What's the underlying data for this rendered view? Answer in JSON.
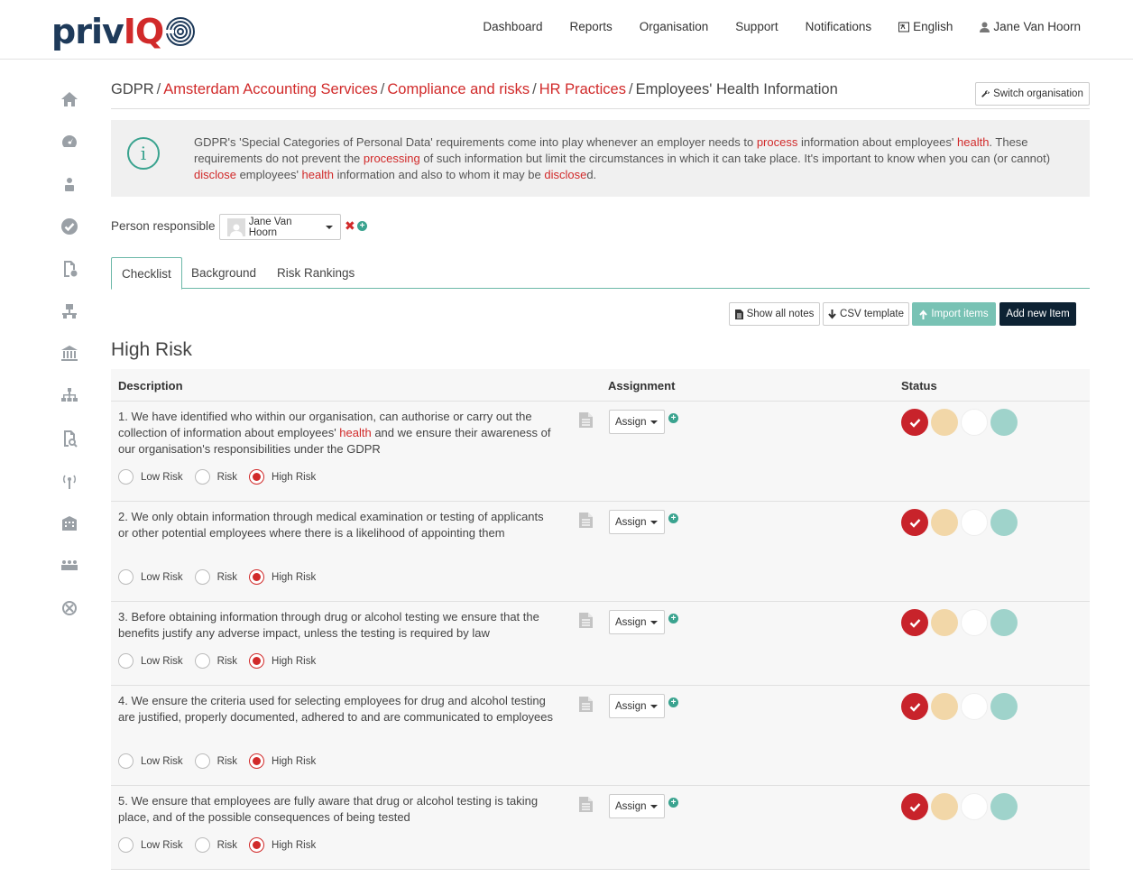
{
  "header": {
    "logo": {
      "part1": "priv",
      "part2": "IQ"
    },
    "nav": [
      {
        "label": "Dashboard",
        "icon": ""
      },
      {
        "label": "Reports",
        "icon": ""
      },
      {
        "label": "Organisation",
        "icon": ""
      },
      {
        "label": "Support",
        "icon": ""
      },
      {
        "label": "Notifications",
        "icon": ""
      },
      {
        "label": "English",
        "icon": "language-icon"
      },
      {
        "label": "Jane Van Hoorn",
        "icon": "user-icon"
      }
    ]
  },
  "sidebar": {
    "icons": [
      "home-icon",
      "dashboard-gauge-icon",
      "person-lock-icon",
      "check-circle-icon",
      "document-gear-icon",
      "network-icon",
      "bank-icon",
      "org-chart-icon",
      "document-search-icon",
      "broadcast-icon",
      "building-icon",
      "group-icon",
      "share-x-icon"
    ]
  },
  "breadcrumb": {
    "root": "GDPR",
    "links": [
      "Amsterdam Accounting Services",
      "Compliance and risks",
      "HR Practices"
    ],
    "current": "Employees' Health Information",
    "separator": "/"
  },
  "switch_org": {
    "label": "Switch organisation",
    "icon": "wrench-icon"
  },
  "info": {
    "icon": "info-icon",
    "segments": [
      {
        "t": "GDPR's 'Special Categories of Personal Data' requirements come into play whenever an employer needs to ",
        "k": false
      },
      {
        "t": "process",
        "k": true
      },
      {
        "t": " information about employees' ",
        "k": false
      },
      {
        "t": "health",
        "k": true
      },
      {
        "t": ". These requirements do not prevent the ",
        "k": false
      },
      {
        "t": "processing",
        "k": true
      },
      {
        "t": " of such information but limit the circumstances in which it can take place. It's important to know when you can (or cannot) ",
        "k": false
      },
      {
        "t": "disclose",
        "k": true
      },
      {
        "t": " employees' ",
        "k": false
      },
      {
        "t": "health",
        "k": true
      },
      {
        "t": " information and also to whom it may be ",
        "k": false
      },
      {
        "t": "disclose",
        "k": true
      },
      {
        "t": "d.",
        "k": false
      }
    ]
  },
  "person_responsible": {
    "label": "Person responsible",
    "value": "Jane Van Hoorn",
    "remove": "✖",
    "add": "+"
  },
  "tabs": [
    {
      "label": "Checklist",
      "active": true
    },
    {
      "label": "Background",
      "active": false
    },
    {
      "label": "Risk Rankings",
      "active": false
    }
  ],
  "toolbar": {
    "show_notes": "Show all notes",
    "csv_template": "CSV template",
    "import_items": "Import items",
    "add_item": "Add new Item"
  },
  "section": {
    "title": "High Risk"
  },
  "table": {
    "headers": {
      "description": "Description",
      "assignment": "Assignment",
      "status": "Status"
    },
    "risk_options": [
      "Low Risk",
      "Risk",
      "High Risk"
    ],
    "assign_label": "Assign",
    "status_colors": {
      "done": "#c8232b",
      "partial": "#f2d7a8",
      "none": "#ffffff",
      "na": "#9fd3cb"
    },
    "rows": [
      {
        "segments": [
          {
            "t": "1. We have identified who within our organisation, can authorise or carry out the collection of information about employees' ",
            "k": false
          },
          {
            "t": "health",
            "k": true
          },
          {
            "t": " and we ensure their awareness of our organisation's responsibilities under the GDPR",
            "k": false
          }
        ],
        "risk": "High Risk"
      },
      {
        "segments": [
          {
            "t": "2. We only obtain information through medical examination or testing of applicants or other potential employees where there is a likelihood of appointing them",
            "k": false
          }
        ],
        "risk": "High Risk"
      },
      {
        "segments": [
          {
            "t": "3. Before obtaining information through drug or alcohol testing we ensure that the benefits justify any adverse impact, unless the testing is required by law",
            "k": false
          }
        ],
        "risk": "High Risk"
      },
      {
        "segments": [
          {
            "t": "4. We ensure the criteria used for selecting employees for drug and alcohol testing are justified, properly documented, adhered to and are communicated to employees",
            "k": false
          }
        ],
        "risk": "High Risk"
      },
      {
        "segments": [
          {
            "t": "5. We ensure that employees are fully aware that drug or alcohol testing is taking place, and of the possible consequences of being tested",
            "k": false
          }
        ],
        "risk": "High Risk"
      }
    ]
  }
}
